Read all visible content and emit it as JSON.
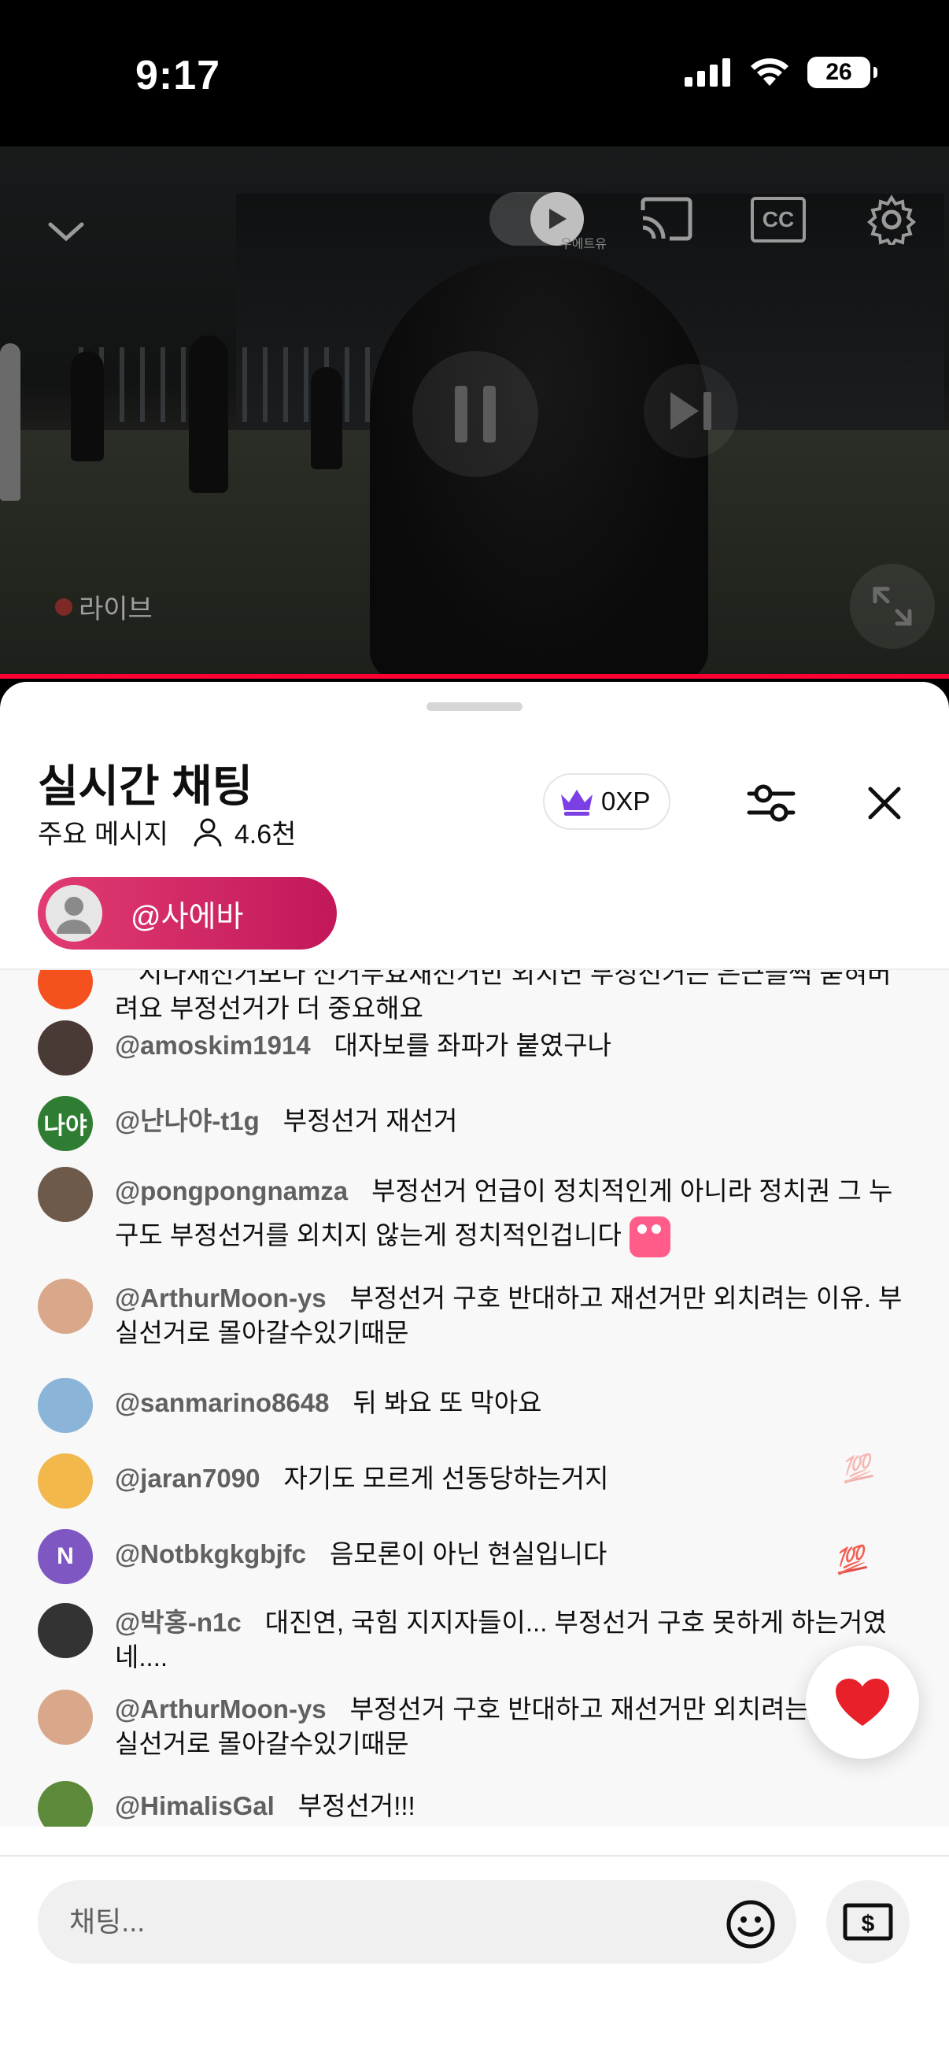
{
  "status_bar": {
    "time": "9:17",
    "battery": "26"
  },
  "video": {
    "live_label": "라이브",
    "watermark": "우에트유"
  },
  "chat_panel": {
    "title": "실시간 채팅",
    "filter_label": "주요 메시지",
    "viewer_count": "4.6천",
    "xp_label": "0XP",
    "pinned_label": "@사에바"
  },
  "messages": [
    {
      "author": "",
      "text": "시다재선거보다 선거무효재선거만 외치면 부정선거는 은근슬쩍 묻혀버려요 부정선거가 더 중요해요",
      "avatar_color": "#f4511e",
      "avatar_text": ""
    },
    {
      "author": "@amoskim1914",
      "text": "대자보를 좌파가 붙였구나",
      "avatar_color": "#4a3a35",
      "avatar_text": ""
    },
    {
      "author": "@난나야-t1g",
      "text": "부정선거 재선거",
      "avatar_color": "#2e7d32",
      "avatar_text": "나야"
    },
    {
      "author": "@pongpongnamza",
      "text": "부정선거 언급이 정치적인게 아니라 정치권 그 누구도 부정선거를 외치지 않는게 정치적인겁니다",
      "avatar_color": "#6d5a4a",
      "avatar_text": ""
    },
    {
      "author": "@ArthurMoon-ys",
      "text": "부정선거 구호 반대하고 재선거만 외치려는 이유. 부실선거로 몰아갈수있기때문",
      "avatar_color": "#d9a88a",
      "avatar_text": ""
    },
    {
      "author": "@sanmarino8648",
      "text": "뒤 봐요 또 막아요",
      "avatar_color": "#8ab4d8",
      "avatar_text": ""
    },
    {
      "author": "@jaran7090",
      "text": "자기도 모르게 선동당하는거지",
      "avatar_color": "#f2b84b",
      "avatar_text": ""
    },
    {
      "author": "@Notbkgkgbjfc",
      "text": "음모론이 아닌 현실입니다",
      "avatar_color": "#7e57c2",
      "avatar_text": "N"
    },
    {
      "author": "@박홍-n1c",
      "text": "대진연, 국힘 지지자들이... 부정선거 구호 못하게 하는거였네....",
      "avatar_color": "#333333",
      "avatar_text": ""
    },
    {
      "author": "@ArthurMoon-ys",
      "text": "부정선거 구호 반대하고 재선거만 외치려는 이유. 부실선거로 몰아갈수있기때문",
      "avatar_color": "#d9a88a",
      "avatar_text": ""
    },
    {
      "author": "@HimalisGal",
      "text": "부정선거!!!",
      "avatar_color": "#5c8a3a",
      "avatar_text": ""
    }
  ],
  "reactions": [
    "💯",
    "💯",
    "💯"
  ],
  "input": {
    "placeholder": "채팅..."
  },
  "icons": {
    "collapse": "chevron-down-icon",
    "autoplay": "autoplay-toggle-icon",
    "cast": "cast-icon",
    "captions": "captions-icon",
    "settings": "gear-icon",
    "pause": "pause-icon",
    "next": "skip-next-icon",
    "fullscreen": "fullscreen-icon",
    "crown": "crown-icon",
    "filter": "sliders-icon",
    "close": "close-icon",
    "heart": "heart-icon",
    "emoji": "smiley-icon",
    "super_chat": "dollar-bill-icon"
  },
  "colors": {
    "accent": "#ff0033",
    "pinned": "#c2185b",
    "crown": "#7b3fe4"
  }
}
